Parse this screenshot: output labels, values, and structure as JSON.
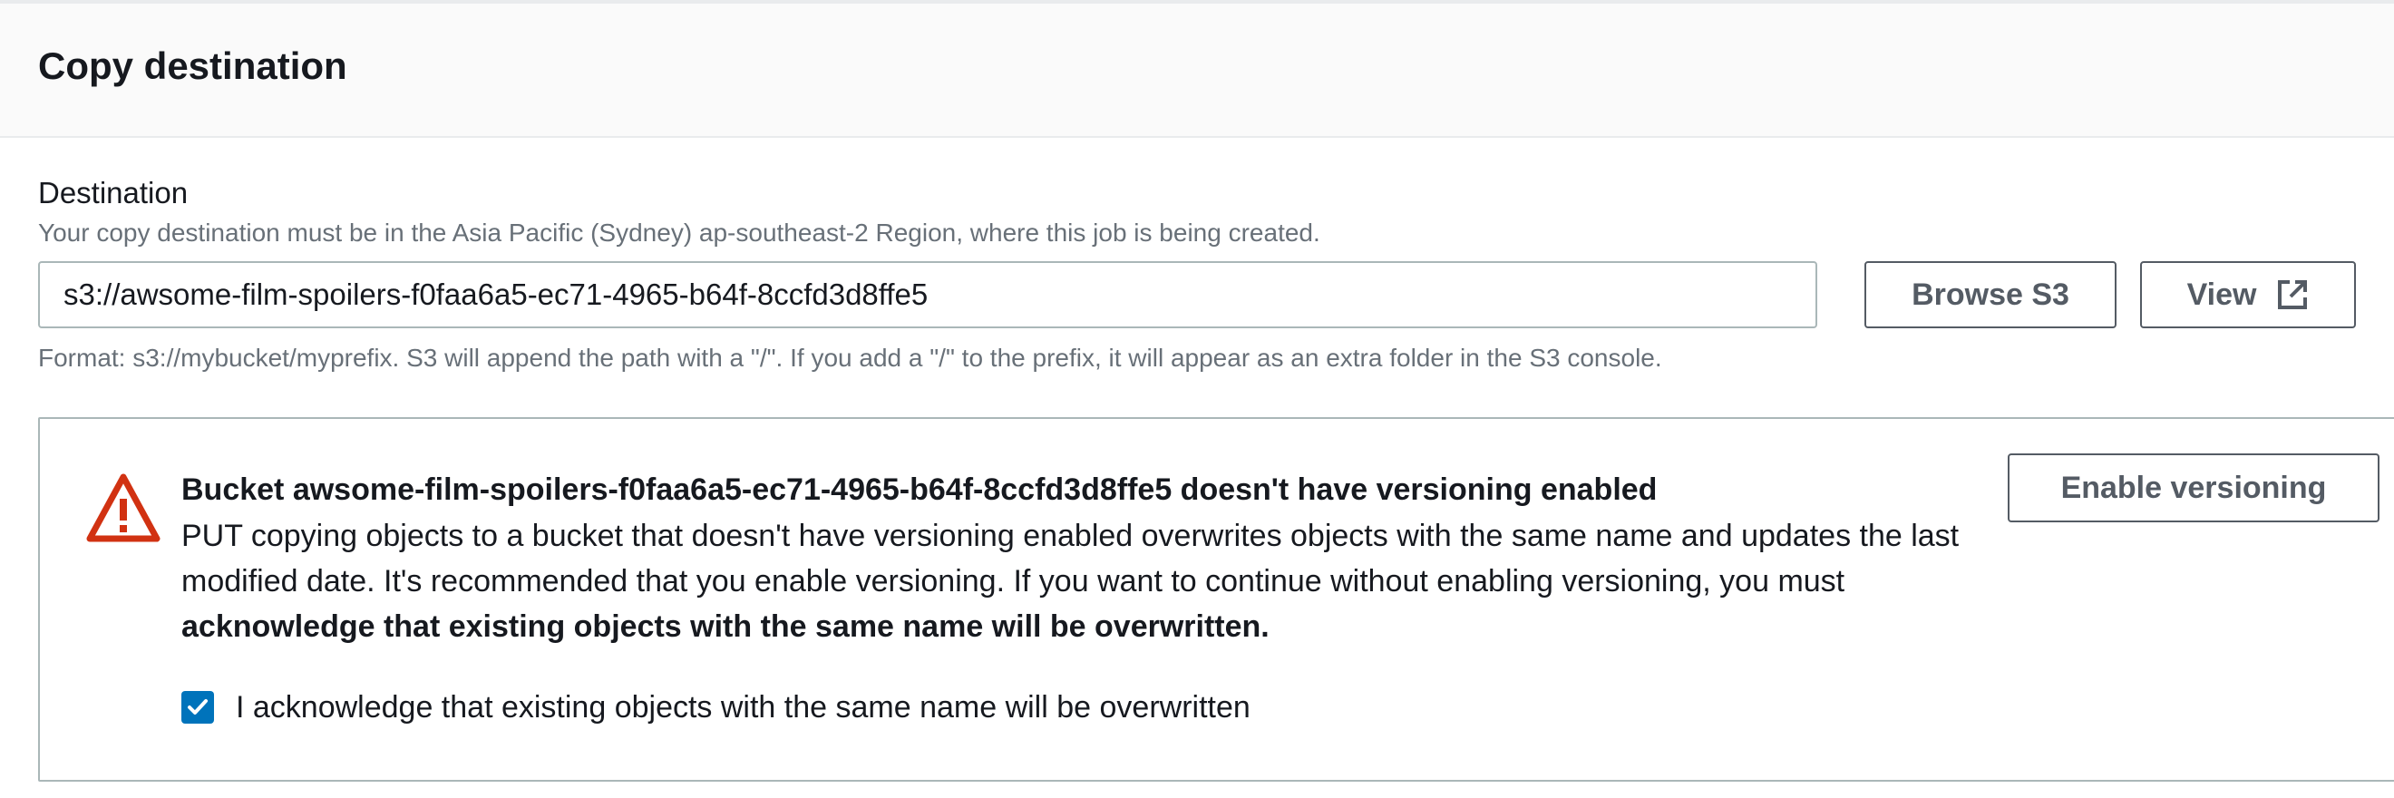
{
  "section": {
    "title": "Copy destination"
  },
  "destination": {
    "label": "Destination",
    "description": "Your copy destination must be in the Asia Pacific (Sydney) ap-southeast-2 Region, where this job is being created.",
    "value": "s3://awsome-film-spoilers-f0faa6a5-ec71-4965-b64f-8ccfd3d8ffe5",
    "browse_label": "Browse S3",
    "view_label": "View",
    "view_icon": "external-link-icon",
    "format_hint": "Format: s3://mybucket/myprefix. S3 will append the path with a \"/\". If you add a \"/\" to the prefix, it will appear as an extra folder in the S3 console."
  },
  "alert": {
    "icon": "warning-icon",
    "icon_color": "#d13212",
    "title": "Bucket awsome-film-spoilers-f0faa6a5-ec71-4965-b64f-8ccfd3d8ffe5 doesn't have versioning enabled",
    "body_text": "PUT copying objects to a bucket that doesn't have versioning enabled overwrites objects with the same name and updates the last modified date. It's recommended that you enable versioning. If you want to continue without enabling versioning, you must ",
    "body_emphasis": "acknowledge that existing objects with the same name will be overwritten.",
    "enable_label": "Enable versioning",
    "acknowledge_label": "I acknowledge that existing objects with the same name will be overwritten",
    "acknowledge_checked": true,
    "checkbox_color": "#0073bb"
  }
}
